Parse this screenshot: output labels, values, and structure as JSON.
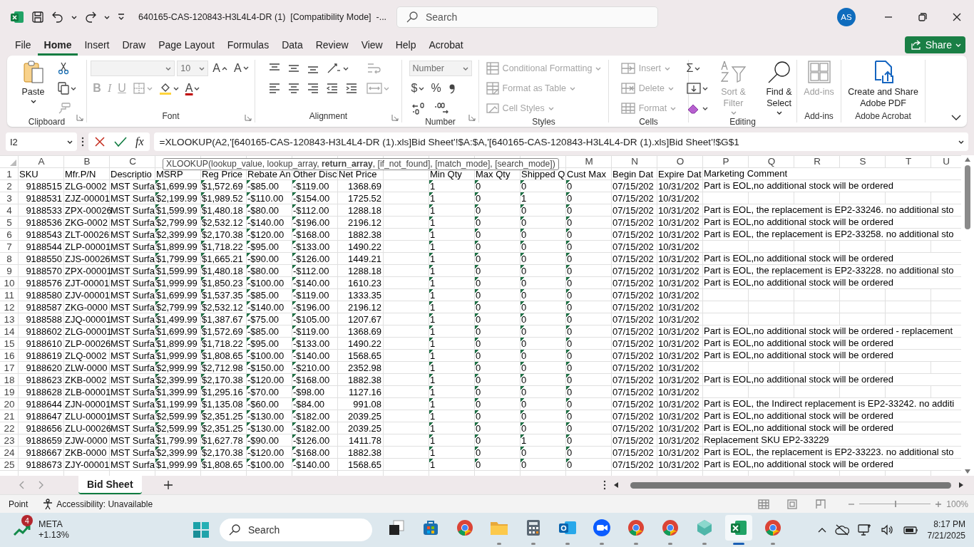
{
  "window": {
    "title": "640165-CAS-120843-H3L4L4-DR (1)  [Compatibility Mode]  -...",
    "search": {
      "placeholder": "Search"
    },
    "account": {
      "initials": "AS"
    }
  },
  "menu_tabs": [
    {
      "label": "File",
      "selected": false
    },
    {
      "label": "Home",
      "selected": true
    },
    {
      "label": "Insert",
      "selected": false
    },
    {
      "label": "Draw",
      "selected": false
    },
    {
      "label": "Page Layout",
      "selected": false
    },
    {
      "label": "Formulas",
      "selected": false
    },
    {
      "label": "Data",
      "selected": false
    },
    {
      "label": "Review",
      "selected": false
    },
    {
      "label": "View",
      "selected": false
    },
    {
      "label": "Help",
      "selected": false
    },
    {
      "label": "Acrobat",
      "selected": false
    }
  ],
  "share_button": {
    "label": "Share"
  },
  "ribbon": {
    "groups": [
      {
        "label": "Clipboard",
        "launcher": true,
        "items": [
          {
            "kind": "paste",
            "label": "Paste",
            "disabled": false
          },
          {
            "kind": "cut",
            "disabled": false
          },
          {
            "kind": "copy",
            "disabled": false
          },
          {
            "kind": "painter",
            "disabled": true
          }
        ]
      },
      {
        "label": "Font",
        "launcher": true,
        "items": [
          {
            "kind": "font-name",
            "disabled": true
          },
          {
            "kind": "font-size",
            "value": "10",
            "disabled": true
          },
          {
            "kind": "grow",
            "label": "A",
            "disabled": false
          },
          {
            "kind": "shrink",
            "label": "A",
            "disabled": false
          },
          {
            "kind": "bold",
            "label": "B",
            "disabled": true
          },
          {
            "kind": "italic",
            "label": "I",
            "disabled": true
          },
          {
            "kind": "underline",
            "label": "U",
            "disabled": true
          },
          {
            "kind": "borders",
            "disabled": true
          },
          {
            "kind": "fill",
            "disabled": false
          },
          {
            "kind": "font-color",
            "label": "A",
            "disabled": false
          }
        ]
      },
      {
        "label": "Alignment",
        "launcher": true,
        "items": [
          {
            "kind": "top",
            "disabled": false
          },
          {
            "kind": "middle",
            "disabled": false
          },
          {
            "kind": "bottom",
            "disabled": false
          },
          {
            "kind": "orientation",
            "disabled": false
          },
          {
            "kind": "left",
            "disabled": false
          },
          {
            "kind": "center",
            "disabled": false
          },
          {
            "kind": "right",
            "disabled": false
          },
          {
            "kind": "outdent",
            "disabled": false
          },
          {
            "kind": "indent",
            "disabled": false
          },
          {
            "kind": "wrap",
            "disabled": true
          },
          {
            "kind": "merge",
            "disabled": true
          }
        ]
      },
      {
        "label": "Number",
        "launcher": true,
        "items": [
          {
            "kind": "number-format",
            "value": "Number",
            "disabled": true
          },
          {
            "kind": "currency",
            "label": "$",
            "disabled": false
          },
          {
            "kind": "percent",
            "label": "%",
            "disabled": false
          },
          {
            "kind": "comma",
            "disabled": false
          },
          {
            "kind": "more-decimal",
            "disabled": false
          },
          {
            "kind": "less-decimal",
            "disabled": false
          }
        ]
      },
      {
        "label": "Styles",
        "launcher": false,
        "items": [
          {
            "kind": "conditional",
            "label": "Conditional Formatting",
            "disabled": true
          },
          {
            "kind": "table",
            "label": "Format as Table",
            "disabled": true
          },
          {
            "kind": "cell-styles",
            "label": "Cell Styles",
            "disabled": true
          }
        ]
      },
      {
        "label": "Cells",
        "launcher": false,
        "items": [
          {
            "kind": "insert",
            "label": "Insert",
            "disabled": true
          },
          {
            "kind": "delete",
            "label": "Delete",
            "disabled": true
          },
          {
            "kind": "format",
            "label": "Format",
            "disabled": true
          }
        ]
      },
      {
        "label": "Editing",
        "launcher": false,
        "items": [
          {
            "kind": "autosum",
            "label": "Σ",
            "disabled": false
          },
          {
            "kind": "fill-down",
            "disabled": false
          },
          {
            "kind": "clear",
            "disabled": false
          },
          {
            "kind": "sort",
            "label": "Sort & Filter",
            "disabled": true
          },
          {
            "kind": "find",
            "label": "Find & Select",
            "disabled": false
          }
        ]
      },
      {
        "label": "Add-ins",
        "launcher": false,
        "items": [
          {
            "kind": "addins",
            "label": "Add-ins",
            "disabled": true
          }
        ]
      },
      {
        "label": "Adobe Acrobat",
        "launcher": false,
        "items": [
          {
            "kind": "pdf",
            "label": "Create and Share Adobe PDF",
            "disabled": false
          }
        ]
      }
    ]
  },
  "formula_bar": {
    "name_box": "I2",
    "function_label": "fx",
    "formula": "=XLOOKUP(A2,'[640165-CAS-120843-H3L4L4-DR (1).xls]Bid Sheet'!$A:$A,'[640165-CAS-120843-H3L4L4-DR (1).xls]Bid Sheet'!$G$1"
  },
  "tooltip": "XLOOKUP(lookup_value, lookup_array, **return_array**, [if_not_found], [match_mode], [search_mode])",
  "sheet": {
    "columns": [
      {
        "letter": "A",
        "kind": "number",
        "flagged": false
      },
      {
        "letter": "B",
        "kind": "text",
        "flagged": false
      },
      {
        "letter": "C",
        "kind": "text",
        "flagged": false
      },
      {
        "kind": "text",
        "flagged": true
      },
      {
        "kind": "text",
        "flagged": true
      },
      {
        "kind": "text",
        "flagged": true
      },
      {
        "kind": "text",
        "flagged": true
      },
      {
        "kind": "number",
        "flagged": false
      },
      {},
      {
        "kind": "text",
        "flagged": true
      },
      {
        "kind": "text",
        "flagged": true
      },
      {
        "kind": "text",
        "flagged": true
      },
      {
        "letter": "M",
        "kind": "text",
        "flagged": true
      },
      {
        "letter": "N",
        "kind": "text",
        "flagged": false
      },
      {
        "letter": "O",
        "kind": "text",
        "flagged": false
      },
      {
        "letter": "P",
        "kind": "text",
        "flagged": false
      },
      {
        "letter": "Q"
      },
      {
        "letter": "R"
      },
      {
        "letter": "S"
      },
      {
        "letter": "T"
      },
      {
        "letter": "U"
      }
    ],
    "rows": [
      {
        "number": "1",
        "kind": "labels",
        "cells": [
          "SKU",
          "Mfr.P/N",
          "Descriptio",
          "MSRP",
          "Reg Price",
          "Rebate An",
          "Other Disc",
          "Net Price",
          null,
          "Min Qty",
          "Max Qty",
          "Shipped Q",
          "Cust Max",
          "Begin Dat",
          "Expire Dat",
          "Marketing Comment"
        ]
      },
      {
        "number": "2",
        "kind": "values",
        "cells": [
          "9188515",
          "ZLG-0002",
          "MST Surfa",
          "$1,699.99",
          "$1,572.69",
          "-$85.00",
          "-$119.00",
          "1368.69",
          null,
          "1",
          "0",
          "0",
          "0",
          "07/15/202",
          "10/31/202",
          "Part is EOL,no additional stock will be ordered"
        ]
      },
      {
        "number": "3",
        "kind": "values",
        "cells": [
          "9188531",
          "ZJZ-00001",
          "MST Surfa",
          "$2,199.99",
          "$1,989.52",
          "-$110.00",
          "-$154.00",
          "1725.52",
          null,
          "1",
          "0",
          "1",
          "0",
          "07/15/202",
          "10/31/202",
          null
        ]
      },
      {
        "number": "4",
        "kind": "values",
        "cells": [
          "9188533",
          "ZPX-00026",
          "MST Surfa",
          "$1,599.99",
          "$1,480.18",
          "-$80.00",
          "-$112.00",
          "1288.18",
          null,
          "1",
          "0",
          "0",
          "0",
          "07/15/202",
          "10/31/202",
          "Part is EOL, the replacement is EP2-33246. no additional sto"
        ]
      },
      {
        "number": "5",
        "kind": "values",
        "cells": [
          "9188536",
          "ZKG-0002",
          "MST Surfa",
          "$2,799.99",
          "$2,532.12",
          "-$140.00",
          "-$196.00",
          "2196.12",
          null,
          "1",
          "0",
          "0",
          "0",
          "07/15/202",
          "10/31/202",
          "Part is EOL,no additional stock will be ordered"
        ]
      },
      {
        "number": "6",
        "kind": "values",
        "cells": [
          "9188543",
          "ZLT-00026",
          "MST Surfa",
          "$2,399.99",
          "$2,170.38",
          "-$120.00",
          "-$168.00",
          "1882.38",
          null,
          "1",
          "0",
          "0",
          "0",
          "07/15/202",
          "10/31/202",
          "Part is EOL, the replacement is EP2-33258. no additional sto"
        ]
      },
      {
        "number": "7",
        "kind": "values",
        "cells": [
          "9188544",
          "ZLP-00001",
          "MST Surfa",
          "$1,899.99",
          "$1,718.22",
          "-$95.00",
          "-$133.00",
          "1490.22",
          null,
          "1",
          "0",
          "0",
          "0",
          "07/15/202",
          "10/31/202",
          null
        ]
      },
      {
        "number": "8",
        "kind": "values",
        "cells": [
          "9188550",
          "ZJS-00026",
          "MST Surfa",
          "$1,799.99",
          "$1,665.21",
          "-$90.00",
          "-$126.00",
          "1449.21",
          null,
          "1",
          "0",
          "0",
          "0",
          "07/15/202",
          "10/31/202",
          "Part is EOL,no additional stock will be ordered"
        ]
      },
      {
        "number": "9",
        "kind": "values",
        "cells": [
          "9188570",
          "ZPX-00001",
          "MST Surfa",
          "$1,599.99",
          "$1,480.18",
          "-$80.00",
          "-$112.00",
          "1288.18",
          null,
          "1",
          "0",
          "0",
          "0",
          "07/15/202",
          "10/31/202",
          "Part is EOL, the replacement is EP2-33228. no additional sto"
        ]
      },
      {
        "number": "10",
        "kind": "values",
        "cells": [
          "9188576",
          "ZJT-00001",
          "MST Surfa",
          "$1,999.99",
          "$1,850.23",
          "-$100.00",
          "-$140.00",
          "1610.23",
          null,
          "1",
          "0",
          "0",
          "0",
          "07/15/202",
          "10/31/202",
          "Part is EOL,no additional stock will be ordered"
        ]
      },
      {
        "number": "11",
        "kind": "values",
        "cells": [
          "9188580",
          "ZJV-00001",
          "MST Surfa",
          "$1,699.99",
          "$1,537.35",
          "-$85.00",
          "-$119.00",
          "1333.35",
          null,
          "1",
          "0",
          "0",
          "0",
          "07/15/202",
          "10/31/202",
          null
        ]
      },
      {
        "number": "12",
        "kind": "values",
        "cells": [
          "9188587",
          "ZKG-0000",
          "MST Surfa",
          "$2,799.99",
          "$2,532.12",
          "-$140.00",
          "-$196.00",
          "2196.12",
          null,
          "1",
          "0",
          "0",
          "0",
          "07/15/202",
          "10/31/202",
          null
        ]
      },
      {
        "number": "13",
        "kind": "values",
        "cells": [
          "9188588",
          "ZJQ-00001",
          "MST Surfa",
          "$1,499.99",
          "$1,387.67",
          "-$75.00",
          "-$105.00",
          "1207.67",
          null,
          "1",
          "0",
          "0",
          "0",
          "07/15/202",
          "10/31/202",
          null
        ]
      },
      {
        "number": "14",
        "kind": "values",
        "cells": [
          "9188602",
          "ZLG-00001",
          "MST Surfa",
          "$1,699.99",
          "$1,572.69",
          "-$85.00",
          "-$119.00",
          "1368.69",
          null,
          "1",
          "0",
          "0",
          "0",
          "07/15/202",
          "10/31/202",
          "Part is EOL,no additional stock will be ordered - replacement"
        ]
      },
      {
        "number": "15",
        "kind": "values",
        "cells": [
          "9188610",
          "ZLP-00026",
          "MST Surfa",
          "$1,899.99",
          "$1,718.22",
          "-$95.00",
          "-$133.00",
          "1490.22",
          null,
          "1",
          "0",
          "0",
          "0",
          "07/15/202",
          "10/31/202",
          "Part is EOL,no additional stock will be ordered"
        ]
      },
      {
        "number": "16",
        "kind": "values",
        "cells": [
          "9188619",
          "ZLQ-0002",
          "MST Surfa",
          "$1,999.99",
          "$1,808.65",
          "-$100.00",
          "-$140.00",
          "1568.65",
          null,
          "1",
          "0",
          "0",
          "0",
          "07/15/202",
          "10/31/202",
          "Part is EOL,no additional stock will be ordered"
        ]
      },
      {
        "number": "17",
        "kind": "values",
        "cells": [
          "9188620",
          "ZLW-0000",
          "MST Surfa",
          "$2,999.99",
          "$2,712.98",
          "-$150.00",
          "-$210.00",
          "2352.98",
          null,
          "1",
          "0",
          "0",
          "0",
          "07/15/202",
          "10/31/202",
          null
        ]
      },
      {
        "number": "18",
        "kind": "values",
        "cells": [
          "9188623",
          "ZKB-0002",
          "MST Surfa",
          "$2,399.99",
          "$2,170.38",
          "-$120.00",
          "-$168.00",
          "1882.38",
          null,
          "1",
          "0",
          "0",
          "0",
          "07/15/202",
          "10/31/202",
          "Part is EOL,no additional stock will be ordered"
        ]
      },
      {
        "number": "19",
        "kind": "values",
        "cells": [
          "9188628",
          "ZLB-00001",
          "MST Surfa",
          "$1,399.99",
          "$1,295.16",
          "-$70.00",
          "-$98.00",
          "1127.16",
          null,
          "1",
          "0",
          "0",
          "0",
          "07/15/202",
          "10/31/202",
          null
        ]
      },
      {
        "number": "20",
        "kind": "values",
        "cells": [
          "9188644",
          "ZJN-00001",
          "MST Surfa",
          "$1,199.99",
          "$1,135.08",
          "-$60.00",
          "-$84.00",
          "991.08",
          null,
          "1",
          "0",
          "0",
          "0",
          "07/15/202",
          "10/31/202",
          "Part is EOL, the Indirect replacement is EP2-33242. no additi"
        ]
      },
      {
        "number": "21",
        "kind": "values",
        "cells": [
          "9188647",
          "ZLU-00001",
          "MST Surfa",
          "$2,599.99",
          "$2,351.25",
          "-$130.00",
          "-$182.00",
          "2039.25",
          null,
          "1",
          "0",
          "0",
          "0",
          "07/15/202",
          "10/31/202",
          "Part is EOL,no additional stock will be ordered"
        ]
      },
      {
        "number": "22",
        "kind": "values",
        "cells": [
          "9188656",
          "ZLU-00026",
          "MST Surfa",
          "$2,599.99",
          "$2,351.25",
          "-$130.00",
          "-$182.00",
          "2039.25",
          null,
          "1",
          "0",
          "0",
          "0",
          "07/15/202",
          "10/31/202",
          "Part is EOL,no additional stock will be ordered"
        ]
      },
      {
        "number": "23",
        "kind": "values",
        "cells": [
          "9188659",
          "ZJW-0000",
          "MST Surfa",
          "$1,799.99",
          "$1,627.78",
          "-$90.00",
          "-$126.00",
          "1411.78",
          null,
          "1",
          "0",
          "1",
          "0",
          "07/15/202",
          "10/31/202",
          "Replacement SKU EP2-33229"
        ]
      },
      {
        "number": "24",
        "kind": "values",
        "cells": [
          "9188667",
          "ZKB-0000",
          "MST Surfa",
          "$2,399.99",
          "$2,170.38",
          "-$120.00",
          "-$168.00",
          "1882.38",
          null,
          "1",
          "0",
          "0",
          "0",
          "07/15/202",
          "10/31/202",
          "Part is EOL, the replacement is EP2-33223. no additional sto"
        ]
      },
      {
        "number": "25",
        "kind": "values",
        "cells": [
          "9188673",
          "ZJY-00001",
          "MST Surfa",
          "$1,999.99",
          "$1,808.65",
          "-$100.00",
          "-$140.00",
          "1568.65",
          null,
          "1",
          "0",
          "0",
          "0",
          "07/15/202",
          "10/31/202",
          "Part is EOL,no additional stock will be ordered"
        ]
      }
    ]
  },
  "sheets": [
    {
      "label": "Bid Sheet",
      "selected": true
    }
  ],
  "status_bar": {
    "mode": "Point",
    "accessibility": "Accessibility: Unavailable",
    "zoom": {
      "level": 0.5,
      "reading": "100%"
    }
  },
  "taskbar": {
    "widget": {
      "badge": "4",
      "symbol": "META",
      "change": "+1.13%"
    },
    "search": {
      "placeholder": "Search"
    },
    "apps": [
      {
        "kind": "taskview",
        "running": false,
        "selected": false
      },
      {
        "kind": "store",
        "running": false,
        "selected": false
      },
      {
        "kind": "browser",
        "running": false,
        "selected": false
      },
      {
        "kind": "folder",
        "running": true,
        "selected": false
      },
      {
        "kind": "calculator",
        "running": true,
        "selected": false
      },
      {
        "kind": "mail",
        "running": true,
        "selected": false
      },
      {
        "kind": "video",
        "running": true,
        "selected": false
      },
      {
        "kind": "browser",
        "running": true,
        "selected": false
      },
      {
        "kind": "browser",
        "running": true,
        "selected": false
      },
      {
        "kind": "cube",
        "running": true,
        "selected": false
      },
      {
        "kind": "sheet",
        "running": true,
        "selected": true
      },
      {
        "kind": "browser",
        "running": true,
        "selected": false
      }
    ],
    "clock": {
      "time": "8:17 PM",
      "date": "7/21/2025"
    }
  }
}
